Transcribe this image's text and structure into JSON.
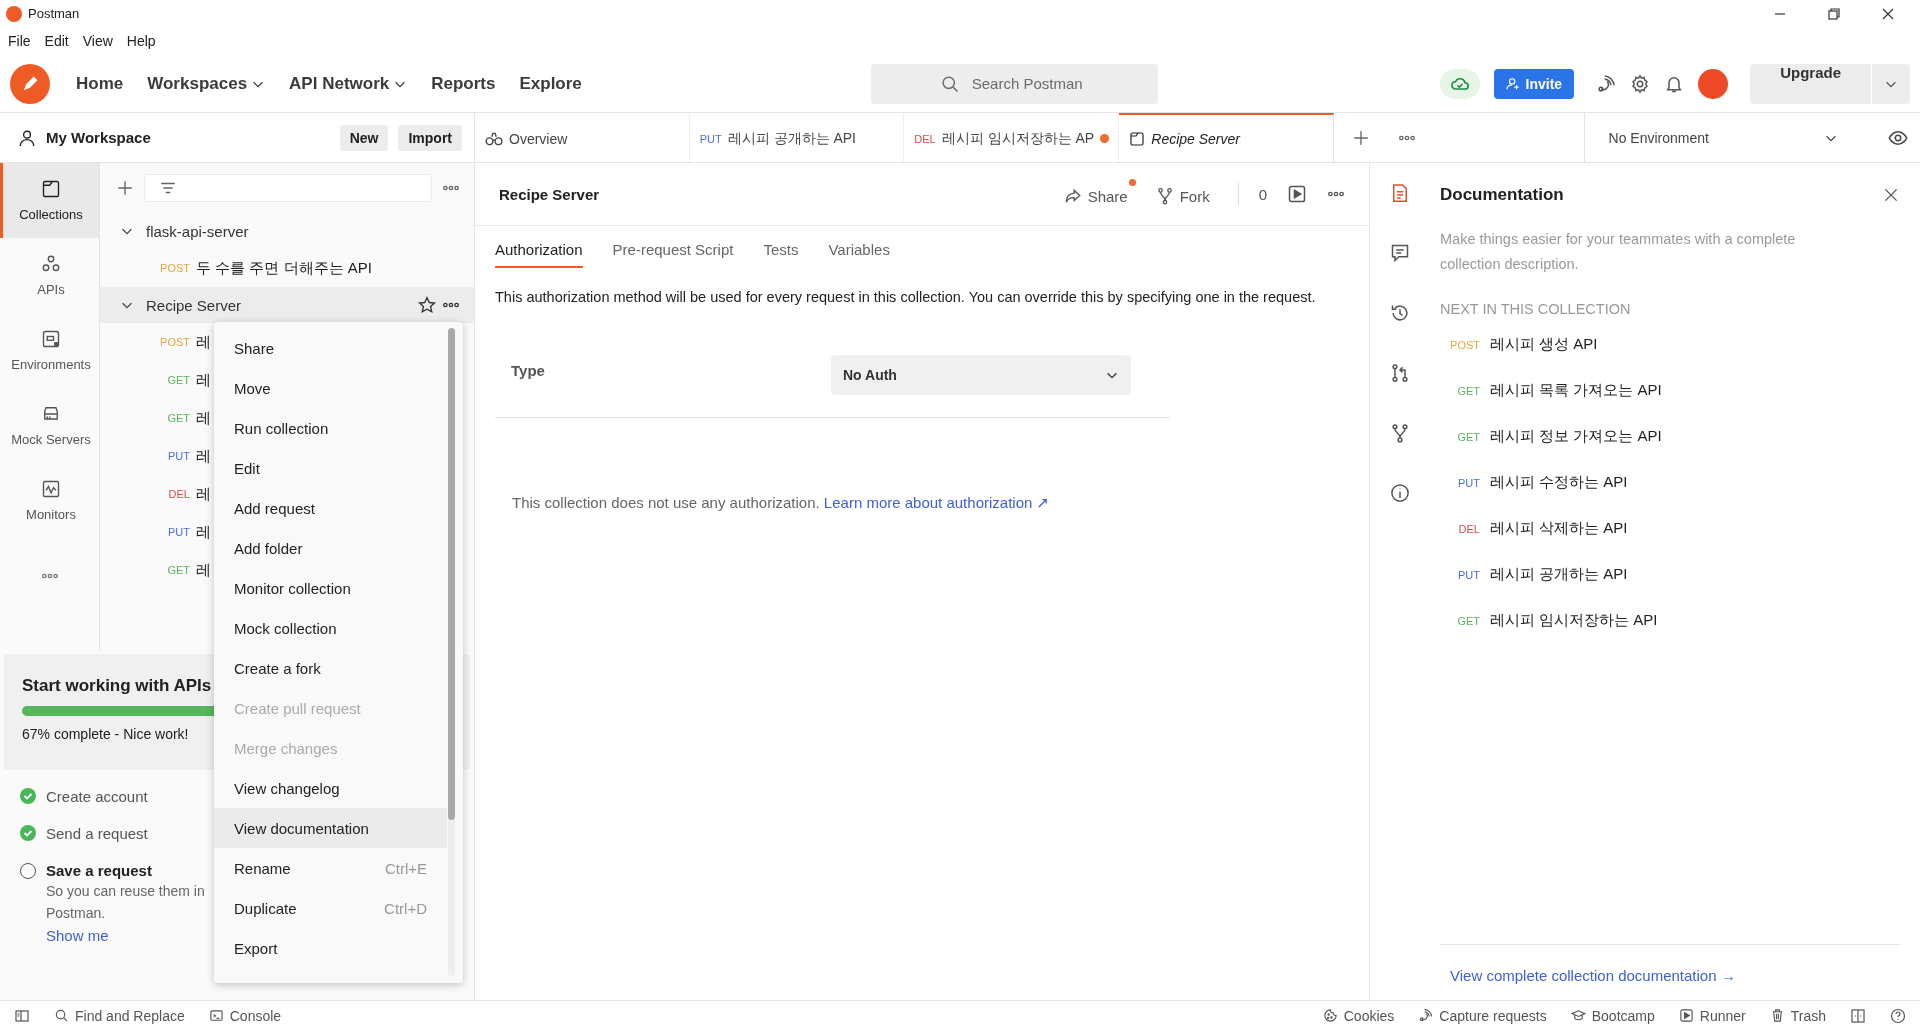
{
  "window": {
    "title": "Postman"
  },
  "menu_bar": [
    "File",
    "Edit",
    "View",
    "Help"
  ],
  "header": {
    "nav": [
      {
        "label": "Home",
        "dropdown": false
      },
      {
        "label": "Workspaces",
        "dropdown": true
      },
      {
        "label": "API Network",
        "dropdown": true
      },
      {
        "label": "Reports",
        "dropdown": false
      },
      {
        "label": "Explore",
        "dropdown": false
      }
    ],
    "search": {
      "placeholder": "Search Postman"
    },
    "invite": "Invite",
    "upgrade": "Upgrade"
  },
  "workspace": {
    "title": "My Workspace",
    "buttons": [
      "New",
      "Import"
    ]
  },
  "sidebar_nav": [
    {
      "label": "Collections",
      "selected": true
    },
    {
      "label": "APIs",
      "selected": false
    },
    {
      "label": "Environments",
      "selected": false
    },
    {
      "label": "Mock Servers",
      "selected": false
    },
    {
      "label": "Monitors",
      "selected": false
    }
  ],
  "tree": [
    {
      "name": "flask-api-server",
      "expanded": true,
      "highlighted": false,
      "children": [
        {
          "method": "POST",
          "color": "#e8a33d",
          "name": "두 수를 주면 더해주는 API"
        }
      ]
    },
    {
      "name": "Recipe Server",
      "expanded": true,
      "highlighted": true,
      "children": [
        {
          "method": "POST",
          "color": "#e8a33d",
          "name": "레"
        },
        {
          "method": "GET",
          "color": "#5bb55b",
          "name": "레"
        },
        {
          "method": "GET",
          "color": "#5bb55b",
          "name": "레"
        },
        {
          "method": "PUT",
          "color": "#4a6ee0",
          "name": "레"
        },
        {
          "method": "DEL",
          "color": "#e04848",
          "name": "레"
        },
        {
          "method": "PUT",
          "color": "#4a6ee0",
          "name": "레"
        },
        {
          "method": "GET",
          "color": "#5bb55b",
          "name": "레"
        }
      ]
    }
  ],
  "context_menu": [
    {
      "label": "Share",
      "disabled": false,
      "highlighted": false
    },
    {
      "label": "Move",
      "disabled": false,
      "highlighted": false
    },
    {
      "label": "Run collection",
      "disabled": false,
      "highlighted": false
    },
    {
      "label": "Edit",
      "disabled": false,
      "highlighted": false
    },
    {
      "label": "Add request",
      "disabled": false,
      "highlighted": false
    },
    {
      "label": "Add folder",
      "disabled": false,
      "highlighted": false
    },
    {
      "label": "Monitor collection",
      "disabled": false,
      "highlighted": false
    },
    {
      "label": "Mock collection",
      "disabled": false,
      "highlighted": false
    },
    {
      "label": "Create a fork",
      "disabled": false,
      "highlighted": false
    },
    {
      "label": "Create pull request",
      "disabled": true,
      "highlighted": false
    },
    {
      "label": "Merge changes",
      "disabled": true,
      "highlighted": false
    },
    {
      "label": "View changelog",
      "disabled": false,
      "highlighted": false
    },
    {
      "label": "View documentation",
      "disabled": false,
      "highlighted": true
    },
    {
      "label": "Rename",
      "shortcut": "Ctrl+E",
      "disabled": false,
      "highlighted": false
    },
    {
      "label": "Duplicate",
      "shortcut": "Ctrl+D",
      "disabled": false,
      "highlighted": false
    },
    {
      "label": "Export",
      "disabled": false,
      "highlighted": false
    }
  ],
  "onboarding": {
    "title": "Start working with APIs",
    "level": 0.67,
    "progress_text": "67% complete - Nice work!",
    "steps": [
      {
        "label": "Create account",
        "done": true,
        "current": false
      },
      {
        "label": "Send a request",
        "done": true,
        "current": false
      },
      {
        "label": "Save a request",
        "done": false,
        "current": true,
        "description_lines": [
          "So you can reuse them in",
          "Postman."
        ],
        "link": "Show me"
      }
    ]
  },
  "tabs": [
    {
      "kind": "overview",
      "label": "Overview",
      "selected": false,
      "unsaved": false
    },
    {
      "kind": "request",
      "method": "PUT",
      "color": "#4a6ee0",
      "label": "레시피 공개하는 API",
      "selected": false,
      "unsaved": false
    },
    {
      "kind": "request",
      "method": "DEL",
      "color": "#e04848",
      "label": "레시피 임시저장하는 AP",
      "selected": false,
      "unsaved": true
    },
    {
      "kind": "collection",
      "label": "Recipe Server",
      "selected": true,
      "unsaved": false
    }
  ],
  "environment": {
    "value": "No Environment"
  },
  "collection": {
    "title": "Recipe Server",
    "actions": {
      "share": "Share",
      "share_notification": true,
      "fork": "Fork",
      "fork_count": "0"
    },
    "tabs": [
      {
        "label": "Authorization",
        "selected": true
      },
      {
        "label": "Pre-request Script",
        "selected": false
      },
      {
        "label": "Tests",
        "selected": false
      },
      {
        "label": "Variables",
        "selected": false
      }
    ],
    "description": "This authorization method will be used for every request in this collection. You can override this by specifying one in the request.",
    "type_label": "Type",
    "type_value": "No Auth",
    "message": "This collection does not use any authorization.",
    "message_link": "Learn more about authorization ↗"
  },
  "documentation": {
    "title": "Documentation",
    "description": "Make things easier for your teammates with a complete collection description.",
    "section": "NEXT IN THIS COLLECTION",
    "requests": [
      {
        "method": "POST",
        "color": "#e8a33d",
        "name": "레시피 생성 API"
      },
      {
        "method": "GET",
        "color": "#5bb55b",
        "name": "레시피 목록 가져오는 API"
      },
      {
        "method": "GET",
        "color": "#5bb55b",
        "name": "레시피 정보 가져오는 API"
      },
      {
        "method": "PUT",
        "color": "#4a6ee0",
        "name": "레시피 수정하는 API"
      },
      {
        "method": "DEL",
        "color": "#e04848",
        "name": "레시피 삭제하는 API"
      },
      {
        "method": "PUT",
        "color": "#4a6ee0",
        "name": "레시피 공개하는 API"
      },
      {
        "method": "GET",
        "color": "#5bb55b",
        "name": "레시피 임시저장하는 API"
      }
    ],
    "link": "View complete collection documentation →"
  },
  "status_bar": {
    "left": [
      "Find and Replace",
      "Console"
    ],
    "right": [
      "Cookies",
      "Capture requests",
      "Bootcamp",
      "Runner",
      "Trash"
    ]
  }
}
